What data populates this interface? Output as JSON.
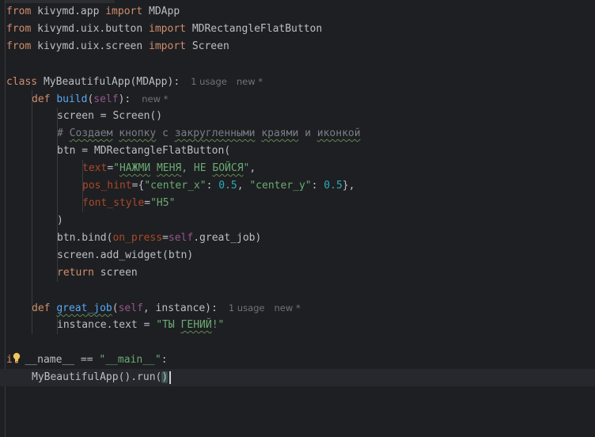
{
  "lines": [
    {
      "tokens": [
        {
          "t": "from",
          "c": "kw"
        },
        {
          "t": " kivymd.app "
        },
        {
          "t": "import",
          "c": "kw"
        },
        {
          "t": " MDApp"
        }
      ]
    },
    {
      "tokens": [
        {
          "t": "from",
          "c": "kw"
        },
        {
          "t": " kivymd.uix.button "
        },
        {
          "t": "import",
          "c": "kw"
        },
        {
          "t": " MDRectangleFlatButton"
        }
      ]
    },
    {
      "tokens": [
        {
          "t": "from",
          "c": "kw"
        },
        {
          "t": " kivymd.uix.screen "
        },
        {
          "t": "import",
          "c": "kw"
        },
        {
          "t": " Screen"
        }
      ]
    },
    {
      "tokens": []
    },
    {
      "tokens": [
        {
          "t": "class",
          "c": "kw"
        },
        {
          "t": " MyBeautifulApp(MDApp):"
        }
      ],
      "hints": [
        "1 usage",
        "new *"
      ]
    },
    {
      "indent": 1,
      "tokens": [
        {
          "t": "def",
          "c": "kw"
        },
        {
          "t": " "
        },
        {
          "t": "build",
          "c": "fn"
        },
        {
          "t": "("
        },
        {
          "t": "self",
          "c": "self"
        },
        {
          "t": "):"
        }
      ],
      "hints": [
        "new *"
      ]
    },
    {
      "indent": 2,
      "tokens": [
        {
          "t": "screen = Screen()"
        }
      ]
    },
    {
      "indent": 2,
      "tokens": [
        {
          "t": "# ",
          "c": "cm"
        },
        {
          "t": "Создаем",
          "c": "cm typo"
        },
        {
          "t": " ",
          "c": "cm"
        },
        {
          "t": "кнопку",
          "c": "cm typo"
        },
        {
          "t": " с ",
          "c": "cm"
        },
        {
          "t": "закругленными",
          "c": "cm typo"
        },
        {
          "t": " ",
          "c": "cm"
        },
        {
          "t": "краями",
          "c": "cm typo"
        },
        {
          "t": " и ",
          "c": "cm"
        },
        {
          "t": "иконкой",
          "c": "cm typo"
        }
      ]
    },
    {
      "indent": 2,
      "tokens": [
        {
          "t": "btn = MDRectangleFlatButton("
        }
      ]
    },
    {
      "indent": 3,
      "tokens": [
        {
          "t": "text",
          "c": "param"
        },
        {
          "t": "="
        },
        {
          "t": "\"",
          "c": "str"
        },
        {
          "t": "НАЖМИ",
          "c": "str typo"
        },
        {
          "t": " ",
          "c": "str"
        },
        {
          "t": "МЕНЯ",
          "c": "str typo"
        },
        {
          "t": ", НЕ ",
          "c": "str"
        },
        {
          "t": "БОЙСЯ",
          "c": "str typo"
        },
        {
          "t": "\"",
          "c": "str"
        },
        {
          "t": ","
        }
      ]
    },
    {
      "indent": 3,
      "tokens": [
        {
          "t": "pos_hint",
          "c": "param"
        },
        {
          "t": "={"
        },
        {
          "t": "\"center_x\"",
          "c": "str"
        },
        {
          "t": ": "
        },
        {
          "t": "0.5",
          "c": "num"
        },
        {
          "t": ", "
        },
        {
          "t": "\"center_y\"",
          "c": "str"
        },
        {
          "t": ": "
        },
        {
          "t": "0.5",
          "c": "num"
        },
        {
          "t": "},"
        }
      ]
    },
    {
      "indent": 3,
      "tokens": [
        {
          "t": "font_style",
          "c": "param"
        },
        {
          "t": "="
        },
        {
          "t": "\"H5\"",
          "c": "str"
        }
      ]
    },
    {
      "indent": 2,
      "tokens": [
        {
          "t": ")"
        }
      ]
    },
    {
      "indent": 2,
      "tokens": [
        {
          "t": "btn.bind("
        },
        {
          "t": "on_press",
          "c": "param"
        },
        {
          "t": "="
        },
        {
          "t": "self",
          "c": "self"
        },
        {
          "t": ".great_job)"
        }
      ]
    },
    {
      "indent": 2,
      "tokens": [
        {
          "t": "screen.add_widget(btn)"
        }
      ]
    },
    {
      "indent": 2,
      "tokens": [
        {
          "t": "return",
          "c": "kw"
        },
        {
          "t": " screen"
        }
      ]
    },
    {
      "tokens": []
    },
    {
      "indent": 1,
      "tokens": [
        {
          "t": "def",
          "c": "kw"
        },
        {
          "t": " "
        },
        {
          "t": "great_job",
          "c": "fn typo"
        },
        {
          "t": "("
        },
        {
          "t": "self",
          "c": "self"
        },
        {
          "t": ", instance):"
        }
      ],
      "hints": [
        "1 usage",
        "new *"
      ]
    },
    {
      "indent": 2,
      "tokens": [
        {
          "t": "instance.text = "
        },
        {
          "t": "\"ТЫ ",
          "c": "str"
        },
        {
          "t": "ГЕНИЙ",
          "c": "str typo"
        },
        {
          "t": "!\"",
          "c": "str"
        }
      ]
    },
    {
      "tokens": []
    },
    {
      "tokens": [
        {
          "t": "if",
          "c": "kw"
        },
        {
          "t": " __name__ == "
        },
        {
          "t": "\"__main__\"",
          "c": "str"
        },
        {
          "t": ":"
        }
      ]
    },
    {
      "indent": 1,
      "current": true,
      "tokens": [
        {
          "t": "MyBeautifulApp().run("
        },
        {
          "t": ")",
          "c": "brace"
        }
      ]
    }
  ],
  "icons": {
    "intention": "lightbulb-icon"
  },
  "colors": {
    "background": "#1e1f22",
    "keyword": "#cf8e6d",
    "function": "#56a8f5",
    "string": "#6aab73",
    "number": "#2aacb8",
    "comment": "#7a7e85",
    "self": "#94558d",
    "named_param": "#aa4926",
    "bulb": "#f2c55c"
  }
}
